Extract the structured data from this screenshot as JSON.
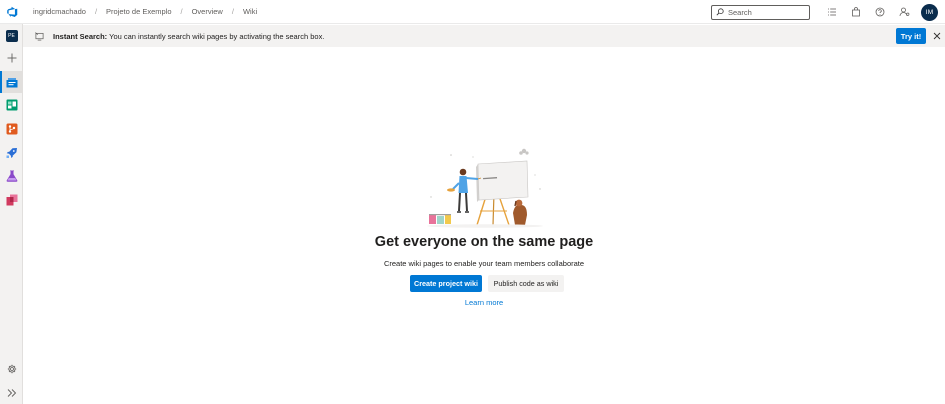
{
  "header": {
    "breadcrumbs": [
      "ingridcmachado",
      "Projeto de Exemplo",
      "Overview",
      "Wiki"
    ],
    "breadcrumb_separator": "/",
    "search_placeholder": "Search",
    "avatar_initials": "IM"
  },
  "sidebar": {
    "project_badge": "PE",
    "items": [
      {
        "name": "project-badge",
        "icon": "project-badge"
      },
      {
        "name": "add",
        "icon": "plus-icon"
      },
      {
        "name": "overview",
        "icon": "overview-icon",
        "active": true
      },
      {
        "name": "boards",
        "icon": "boards-icon"
      },
      {
        "name": "repos",
        "icon": "repos-icon"
      },
      {
        "name": "pipelines",
        "icon": "pipelines-icon"
      },
      {
        "name": "test-plans",
        "icon": "test-plans-icon"
      },
      {
        "name": "artifacts",
        "icon": "artifacts-icon"
      }
    ],
    "bottom_items": [
      {
        "name": "project-settings",
        "icon": "gear-icon"
      },
      {
        "name": "expand",
        "icon": "double-chevron-right-icon"
      }
    ]
  },
  "banner": {
    "title": "Instant Search:",
    "message": " You can instantly search wiki pages by activating the search box.",
    "action_label": "Try it!"
  },
  "main": {
    "headline": "Get everyone on the same page",
    "subtitle": "Create wiki pages to enable your team members collaborate",
    "primary_button": "Create project wiki",
    "secondary_button": "Publish code as wiki",
    "link": "Learn more"
  },
  "colors": {
    "accent": "#0078d4",
    "rail_bg": "#f3f2f1",
    "avatar_bg": "#0b2d4d"
  }
}
